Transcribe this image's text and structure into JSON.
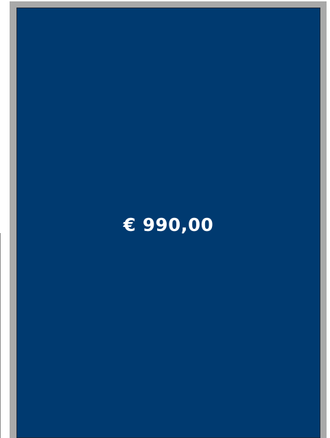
{
  "card": {
    "price": "€ 990,00"
  },
  "colors": {
    "panel_background": "#003a70",
    "frame": "#a9a9a9",
    "price_text": "#ffffff"
  }
}
